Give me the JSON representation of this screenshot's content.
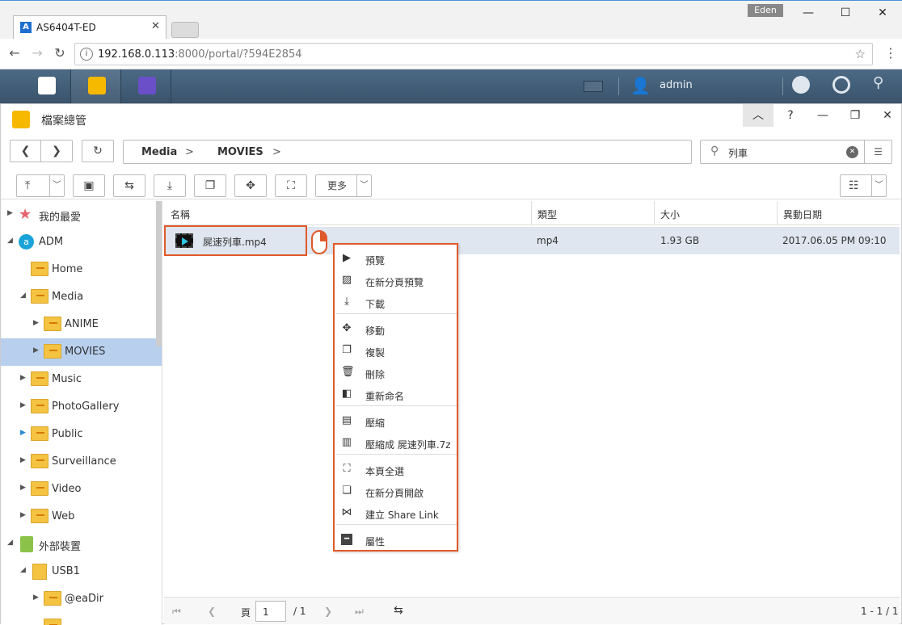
{
  "browser": {
    "tab_title": "AS6404T-ED",
    "profile_name": "Eden",
    "url_host": "192.168.0.113",
    "url_rest": ":8000/portal/?594E2854"
  },
  "taskbar": {
    "user": "admin"
  },
  "window": {
    "title": "檔案總管"
  },
  "breadcrumb": [
    "Media",
    "MOVIES"
  ],
  "search": {
    "value": "列車"
  },
  "toolbar": {
    "more_label": "更多"
  },
  "sidebar": {
    "items": [
      {
        "label": "我的最愛"
      },
      {
        "label": "ADM"
      },
      {
        "label": "Home"
      },
      {
        "label": "Media"
      },
      {
        "label": "ANIME"
      },
      {
        "label": "MOVIES"
      },
      {
        "label": "Music"
      },
      {
        "label": "PhotoGallery"
      },
      {
        "label": "Public"
      },
      {
        "label": "Surveillance"
      },
      {
        "label": "Video"
      },
      {
        "label": "Web"
      },
      {
        "label": "外部裝置"
      },
      {
        "label": "USB1"
      },
      {
        "label": "@eaDir"
      }
    ]
  },
  "list": {
    "columns": [
      "名稱",
      "類型",
      "大小",
      "異動日期"
    ],
    "rows": [
      {
        "name": "屍速列車.mp4",
        "type": "mp4",
        "size": "1.93 GB",
        "modified": "2017.06.05 PM 09:10"
      }
    ]
  },
  "context_menu": {
    "items": [
      {
        "label": "預覽",
        "icon": "preview-icon"
      },
      {
        "label": "在新分頁預覽",
        "icon": "image-icon"
      },
      {
        "label": "下載",
        "icon": "download-icon"
      },
      {
        "label": "移動",
        "icon": "move-icon"
      },
      {
        "label": "複製",
        "icon": "copy-icon"
      },
      {
        "label": "刪除",
        "icon": "trash-icon"
      },
      {
        "label": "重新命名",
        "icon": "rename-icon"
      },
      {
        "label": "壓縮",
        "icon": "compress-icon"
      },
      {
        "label": "壓縮成 屍速列車.7z",
        "icon": "zip-icon"
      },
      {
        "label": "本頁全選",
        "icon": "select-all-icon"
      },
      {
        "label": "在新分頁開啟",
        "icon": "new-tab-icon"
      },
      {
        "label": "建立 Share Link",
        "icon": "share-icon"
      },
      {
        "label": "屬性",
        "icon": "properties-icon"
      }
    ]
  },
  "pager": {
    "page_label": "頁",
    "page_value": "1",
    "page_total": "/ 1",
    "range": "1 - 1 / 1"
  },
  "colors": {
    "accent": "#e0592a",
    "selection": "#b8d0ee",
    "taskbar": "#435f79"
  }
}
